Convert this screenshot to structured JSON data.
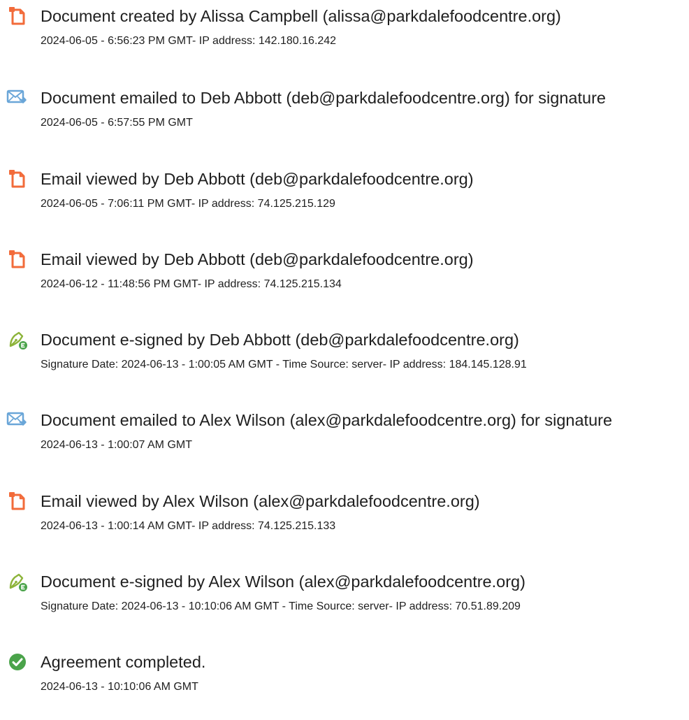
{
  "colors": {
    "doc_icon": "#f26b3a",
    "email_icon": "#6aa6d8",
    "sign_icon": "#8db43a",
    "complete_icon": "#4aa34a",
    "text": "#1f1f1f"
  },
  "events": [
    {
      "icon": "document-icon",
      "title": "Document created by Alissa Campbell (alissa@parkdalefoodcentre.org)",
      "detail": "2024-06-05 - 6:56:23 PM GMT- IP address: 142.180.16.242"
    },
    {
      "icon": "email-sent-icon",
      "title": "Document emailed to Deb Abbott (deb@parkdalefoodcentre.org) for signature",
      "detail": "2024-06-05 - 6:57:55 PM GMT"
    },
    {
      "icon": "document-icon",
      "title": "Email viewed by Deb Abbott (deb@parkdalefoodcentre.org)",
      "detail": "2024-06-05 - 7:06:11 PM GMT- IP address: 74.125.215.129"
    },
    {
      "icon": "document-icon",
      "title": "Email viewed by Deb Abbott (deb@parkdalefoodcentre.org)",
      "detail": "2024-06-12 - 11:48:56 PM GMT- IP address: 74.125.215.134"
    },
    {
      "icon": "e-sign-pen-icon",
      "title": "Document e-signed by Deb Abbott (deb@parkdalefoodcentre.org)",
      "detail": "Signature Date: 2024-06-13 - 1:00:05 AM GMT - Time Source: server- IP address: 184.145.128.91"
    },
    {
      "icon": "email-sent-icon",
      "title": "Document emailed to Alex Wilson (alex@parkdalefoodcentre.org) for signature",
      "detail": "2024-06-13 - 1:00:07 AM GMT"
    },
    {
      "icon": "document-icon",
      "title": "Email viewed by Alex Wilson (alex@parkdalefoodcentre.org)",
      "detail": "2024-06-13 - 1:00:14 AM GMT- IP address: 74.125.215.133"
    },
    {
      "icon": "e-sign-pen-icon",
      "title": "Document e-signed by Alex Wilson (alex@parkdalefoodcentre.org)",
      "detail": "Signature Date: 2024-06-13 - 10:10:06 AM GMT - Time Source: server- IP address: 70.51.89.209"
    },
    {
      "icon": "check-circle-icon",
      "title": "Agreement completed.",
      "detail": "2024-06-13 - 10:10:06 AM GMT"
    }
  ]
}
